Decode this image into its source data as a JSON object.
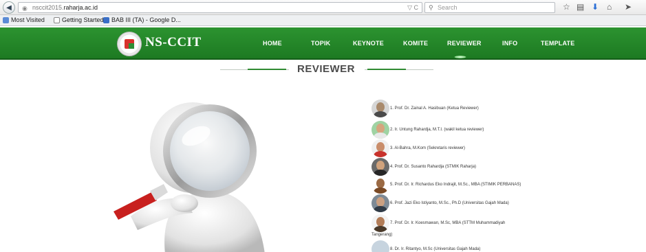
{
  "browser": {
    "url_prefix": "nsccit2015.",
    "url_domain": "raharja.ac.id",
    "search_placeholder": "Search",
    "bookmarks": [
      {
        "label": "Most Visited",
        "color": "#5b8bd6"
      },
      {
        "label": "Getting Started",
        "color": "#ffffff"
      },
      {
        "label": "BAB III (TA) - Google D...",
        "color": "#3a6fc7"
      }
    ]
  },
  "site": {
    "brand": "NS-CCIT",
    "nav": [
      "HOME",
      "TOPIK",
      "KEYNOTE",
      "KOMITE",
      "REVIEWER",
      "INFO",
      "TEMPLATE"
    ],
    "active_nav": "REVIEWER",
    "nav_color": "#2a8f2e"
  },
  "page": {
    "title": "REVIEWER"
  },
  "reviewers": [
    {
      "text": "1. Prof. Dr. Zainal A. Hasibuan (Ketua Reviewer)",
      "bg": "#d6d6d6",
      "face": "#a98a6c",
      "body": "#4a4a4a"
    },
    {
      "text": "2. Ir. Untung Rahardja, M.T.I. (wakil ketua reviewer)",
      "bg": "#9fd3a3",
      "face": "#d6a57e",
      "body": "#e9e9e9"
    },
    {
      "text": "3. Al-Bahra, M.Kom (Sekretaris reviewer)",
      "bg": "#f0f0f0",
      "face": "#c98d6a",
      "body": "#c8322c"
    },
    {
      "text": "4. Prof. Dr. Susanto Rahardja (STMIK Raharja)",
      "bg": "#6a6a6a",
      "face": "#d0a27c",
      "body": "#262626"
    },
    {
      "text": "5. Prof. Dr. Ir. Richardus Eko Indrajit, M.Sc., MBA (STIMIK PERBANAS)",
      "bg": "#ffffff",
      "face": "#9b6a44",
      "body": "#7a4a26"
    },
    {
      "text": "6. Prof. Jazi Eko Istiyanto, M.Sc., Ph.D (Universitas Gajah Mada)",
      "bg": "#7d8a96",
      "face": "#caa082",
      "body": "#2f3a46"
    },
    {
      "text": "7. Prof. Dr. Ir. Koesmawan, M.Sc, MBA (STTM Muhammadiyah",
      "text2": "Tangerang)",
      "bg": "#f3f3f3",
      "face": "#b27c57",
      "body": "#4a3a2a"
    },
    {
      "text": "8. Dr. Ir. Ritantyo, M.Sc (Universitas Gajah Mada)",
      "bg": "#c7d4df",
      "face": "#c7d4df",
      "body": "#c7d4df"
    }
  ]
}
